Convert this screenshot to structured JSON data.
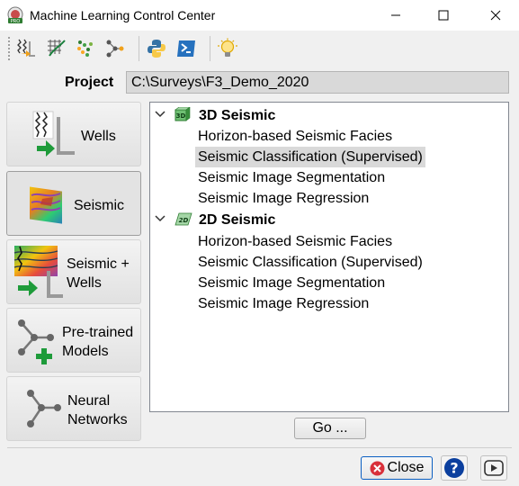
{
  "window": {
    "title": "Machine Learning Control Center",
    "app_icon_badge": "PRO"
  },
  "project": {
    "label": "Project",
    "path": "C:\\Surveys\\F3_Demo_2020"
  },
  "sidebar": {
    "wells": "Wells",
    "seismic": "Seismic",
    "seismic_wells": [
      "Seismic +",
      "Wells"
    ],
    "pretrained": [
      "Pre-trained",
      "Models"
    ],
    "neural": [
      "Neural",
      "Networks"
    ]
  },
  "tree": {
    "groups": [
      {
        "label": "3D Seismic",
        "icon_text": "3D",
        "items": [
          "Horizon-based Seismic Facies",
          "Seismic Classification (Supervised)",
          "Seismic Image Segmentation",
          "Seismic Image Regression"
        ]
      },
      {
        "label": "2D Seismic",
        "icon_text": "2D",
        "items": [
          "Horizon-based Seismic Facies",
          "Seismic Classification (Supervised)",
          "Seismic Image Segmentation",
          "Seismic Image Regression"
        ]
      }
    ]
  },
  "buttons": {
    "go": "Go ...",
    "close": "Close"
  },
  "colors": {
    "selection": "#d9d9d9",
    "accent_blue": "#0b5fc2",
    "close_red": "#d9303a"
  }
}
